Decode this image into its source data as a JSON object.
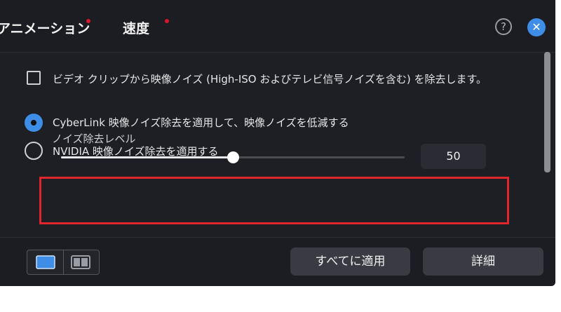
{
  "tabs": [
    {
      "label": "アニメーション",
      "indicator": "#e0152b"
    },
    {
      "label": "速度",
      "indicator": "#e0152b"
    }
  ],
  "header": {
    "help_icon": "question-circle-icon",
    "close_icon": "close-icon",
    "close_color": "#3e8ee8"
  },
  "options": {
    "denoise_checkbox": {
      "label": "ビデオ クリップから映像ノイズ (High-ISO およびテレビ信号ノイズを含む) を除去します。",
      "checked": false
    },
    "radio_group": [
      {
        "label": "CyberLink 映像ノイズ除去を適用して、映像ノイズを低減する",
        "selected": true
      },
      {
        "label": "NVIDIA 映像ノイズ除去を適用する",
        "selected": false
      }
    ]
  },
  "noise_level": {
    "label": "ノイズ除去レベル",
    "value": "50",
    "min": 0,
    "max": 100
  },
  "footer": {
    "view_toggle": [
      "single-view-icon",
      "split-view-icon"
    ],
    "apply_all_label": "すべてに適用",
    "details_label": "詳細"
  },
  "accent_color": "#3e8ee8",
  "highlight_color": "#e0262c"
}
